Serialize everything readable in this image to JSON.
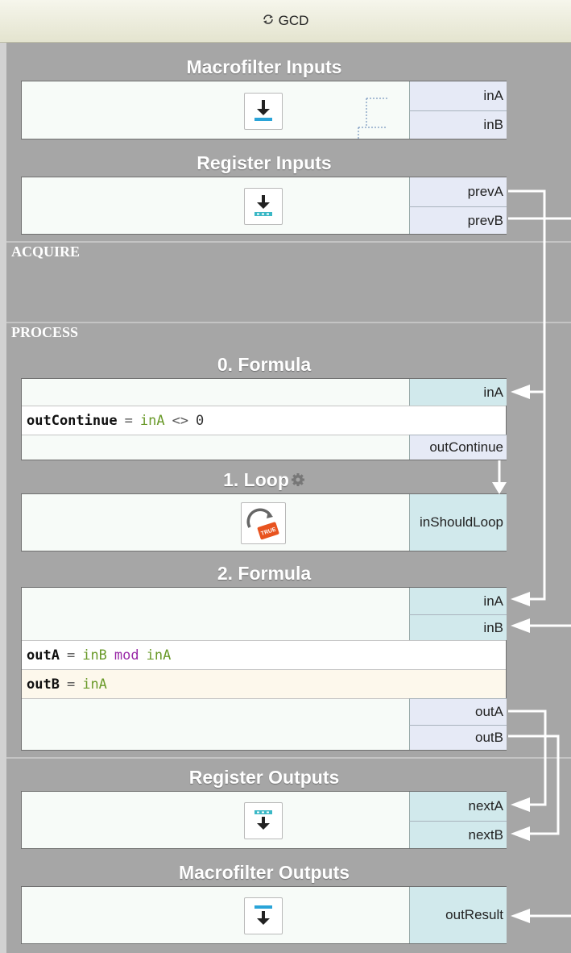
{
  "window": {
    "title": "GCD",
    "icon": "refresh-icon"
  },
  "blocks": {
    "macro_inputs": {
      "title": "Macrofilter Inputs",
      "icon": "download-icon",
      "ports": [
        "inA",
        "inB"
      ]
    },
    "register_inputs": {
      "title": "Register Inputs",
      "icon": "register-download-icon",
      "ports": [
        "prevA",
        "prevB"
      ]
    },
    "formula0": {
      "title": "0. Formula",
      "in_ports": [
        "inA"
      ],
      "out_ports": [
        "outContinue"
      ],
      "expr": {
        "target": "outContinue",
        "eq": "=",
        "arg": "inA",
        "op": "<>",
        "val": "0"
      }
    },
    "loop1": {
      "title": "1. Loop",
      "icon": "loop-true-icon",
      "settings_icon": "gear-icon",
      "in_ports": [
        "inShouldLoop"
      ]
    },
    "formula2": {
      "title": "2. Formula",
      "in_ports": [
        "inA",
        "inB"
      ],
      "out_ports": [
        "outA",
        "outB"
      ],
      "expr1": {
        "target": "outA",
        "eq": "=",
        "a": "inB",
        "fn": "mod",
        "b": "inA"
      },
      "expr2": {
        "target": "outB",
        "eq": "=",
        "a": "inA"
      }
    },
    "register_outputs": {
      "title": "Register Outputs",
      "icon": "register-upload-icon",
      "ports": [
        "nextA",
        "nextB"
      ]
    },
    "macro_outputs": {
      "title": "Macrofilter Outputs",
      "icon": "upload-icon",
      "ports": [
        "outResult"
      ]
    }
  },
  "sections": {
    "acquire": "ACQUIRE",
    "process": "PROCESS"
  },
  "colors": {
    "title_bar": "#eeeedd",
    "background": "#a6a6a6",
    "input_port": "#d1e9ec",
    "output_port": "#e6eaf6",
    "accent_blue": "#2aa4d8",
    "keyword_green": "#6a9a2a",
    "keyword_purple": "#9a2aa8"
  }
}
